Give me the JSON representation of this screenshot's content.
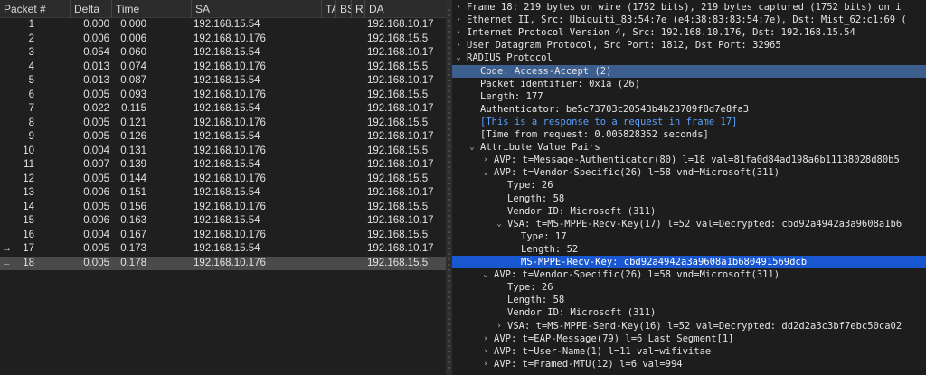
{
  "packet_list": {
    "columns": [
      {
        "label": "Packet #"
      },
      {
        "label": "Delta"
      },
      {
        "label": "Time"
      },
      {
        "label": "SA"
      },
      {
        "label": "TA"
      },
      {
        "label": "BS"
      },
      {
        "label": "RA"
      },
      {
        "label": "DA"
      }
    ],
    "rows": [
      {
        "no": "1",
        "delta": "0.000",
        "time": "0.000",
        "sa": "192.168.15.54",
        "da": "192.168.10.17",
        "marker": ""
      },
      {
        "no": "2",
        "delta": "0.006",
        "time": "0.006",
        "sa": "192.168.10.176",
        "da": "192.168.15.5",
        "marker": ""
      },
      {
        "no": "3",
        "delta": "0.054",
        "time": "0.060",
        "sa": "192.168.15.54",
        "da": "192.168.10.17",
        "marker": ""
      },
      {
        "no": "4",
        "delta": "0.013",
        "time": "0.074",
        "sa": "192.168.10.176",
        "da": "192.168.15.5",
        "marker": ""
      },
      {
        "no": "5",
        "delta": "0.013",
        "time": "0.087",
        "sa": "192.168.15.54",
        "da": "192.168.10.17",
        "marker": ""
      },
      {
        "no": "6",
        "delta": "0.005",
        "time": "0.093",
        "sa": "192.168.10.176",
        "da": "192.168.15.5",
        "marker": ""
      },
      {
        "no": "7",
        "delta": "0.022",
        "time": "0.115",
        "sa": "192.168.15.54",
        "da": "192.168.10.17",
        "marker": ""
      },
      {
        "no": "8",
        "delta": "0.005",
        "time": "0.121",
        "sa": "192.168.10.176",
        "da": "192.168.15.5",
        "marker": ""
      },
      {
        "no": "9",
        "delta": "0.005",
        "time": "0.126",
        "sa": "192.168.15.54",
        "da": "192.168.10.17",
        "marker": ""
      },
      {
        "no": "10",
        "delta": "0.004",
        "time": "0.131",
        "sa": "192.168.10.176",
        "da": "192.168.15.5",
        "marker": ""
      },
      {
        "no": "11",
        "delta": "0.007",
        "time": "0.139",
        "sa": "192.168.15.54",
        "da": "192.168.10.17",
        "marker": ""
      },
      {
        "no": "12",
        "delta": "0.005",
        "time": "0.144",
        "sa": "192.168.10.176",
        "da": "192.168.15.5",
        "marker": ""
      },
      {
        "no": "13",
        "delta": "0.006",
        "time": "0.151",
        "sa": "192.168.15.54",
        "da": "192.168.10.17",
        "marker": ""
      },
      {
        "no": "14",
        "delta": "0.005",
        "time": "0.156",
        "sa": "192.168.10.176",
        "da": "192.168.15.5",
        "marker": ""
      },
      {
        "no": "15",
        "delta": "0.006",
        "time": "0.163",
        "sa": "192.168.15.54",
        "da": "192.168.10.17",
        "marker": ""
      },
      {
        "no": "16",
        "delta": "0.004",
        "time": "0.167",
        "sa": "192.168.10.176",
        "da": "192.168.15.5",
        "marker": ""
      },
      {
        "no": "17",
        "delta": "0.005",
        "time": "0.173",
        "sa": "192.168.15.54",
        "da": "192.168.10.17",
        "marker": "→"
      },
      {
        "no": "18",
        "delta": "0.005",
        "time": "0.178",
        "sa": "192.168.10.176",
        "da": "192.168.15.5",
        "marker": "←"
      }
    ]
  },
  "details": [
    {
      "indent": 0,
      "twisty": "›",
      "text": "Frame 18: 219 bytes on wire (1752 bits), 219 bytes captured (1752 bits) on i"
    },
    {
      "indent": 0,
      "twisty": "›",
      "text": "Ethernet II, Src: Ubiquiti_83:54:7e (e4:38:83:83:54:7e), Dst: Mist_62:c1:69 ("
    },
    {
      "indent": 0,
      "twisty": "›",
      "text": "Internet Protocol Version 4, Src: 192.168.10.176, Dst: 192.168.15.54"
    },
    {
      "indent": 0,
      "twisty": "›",
      "text": "User Datagram Protocol, Src Port: 1812, Dst Port: 32965"
    },
    {
      "indent": 0,
      "twisty": "⌄",
      "text": "RADIUS Protocol"
    },
    {
      "indent": 1,
      "twisty": "",
      "text": "Code: Access-Accept (2)",
      "style": "selgray"
    },
    {
      "indent": 1,
      "twisty": "",
      "text": "Packet identifier: 0x1a (26)"
    },
    {
      "indent": 1,
      "twisty": "",
      "text": "Length: 177"
    },
    {
      "indent": 1,
      "twisty": "",
      "text": "Authenticator: be5c73703c20543b4b23709f8d7e8fa3"
    },
    {
      "indent": 1,
      "twisty": "",
      "text": "[This is a response to a request in frame 17]",
      "style": "link"
    },
    {
      "indent": 1,
      "twisty": "",
      "text": "[Time from request: 0.005828352 seconds]"
    },
    {
      "indent": 1,
      "twisty": "⌄",
      "text": "Attribute Value Pairs"
    },
    {
      "indent": 2,
      "twisty": "›",
      "text": "AVP: t=Message-Authenticator(80) l=18 val=81fa0d84ad198a6b11138028d80b5"
    },
    {
      "indent": 2,
      "twisty": "⌄",
      "text": "AVP: t=Vendor-Specific(26) l=58 vnd=Microsoft(311)"
    },
    {
      "indent": 3,
      "twisty": "",
      "text": "Type: 26"
    },
    {
      "indent": 3,
      "twisty": "",
      "text": "Length: 58"
    },
    {
      "indent": 3,
      "twisty": "",
      "text": "Vendor ID: Microsoft (311)"
    },
    {
      "indent": 3,
      "twisty": "⌄",
      "text": "VSA: t=MS-MPPE-Recv-Key(17) l=52 val=Decrypted: cbd92a4942a3a9608a1b6"
    },
    {
      "indent": 4,
      "twisty": "",
      "text": "Type: 17"
    },
    {
      "indent": 4,
      "twisty": "",
      "text": "Length: 52"
    },
    {
      "indent": 4,
      "twisty": "",
      "text": "MS-MPPE-Recv-Key: cbd92a4942a3a9608a1b680491569dcb",
      "style": "selblue"
    },
    {
      "indent": 2,
      "twisty": "⌄",
      "text": "AVP: t=Vendor-Specific(26) l=58 vnd=Microsoft(311)"
    },
    {
      "indent": 3,
      "twisty": "",
      "text": "Type: 26"
    },
    {
      "indent": 3,
      "twisty": "",
      "text": "Length: 58"
    },
    {
      "indent": 3,
      "twisty": "",
      "text": "Vendor ID: Microsoft (311)"
    },
    {
      "indent": 3,
      "twisty": "›",
      "text": "VSA: t=MS-MPPE-Send-Key(16) l=52 val=Decrypted: dd2d2a3c3bf7ebc50ca02"
    },
    {
      "indent": 2,
      "twisty": "›",
      "text": "AVP: t=EAP-Message(79) l=6 Last Segment[1]"
    },
    {
      "indent": 2,
      "twisty": "›",
      "text": "AVP: t=User-Name(1) l=11 val=wifivitae"
    },
    {
      "indent": 2,
      "twisty": "›",
      "text": "AVP: t=Framed-MTU(12) l=6 val=994"
    }
  ]
}
